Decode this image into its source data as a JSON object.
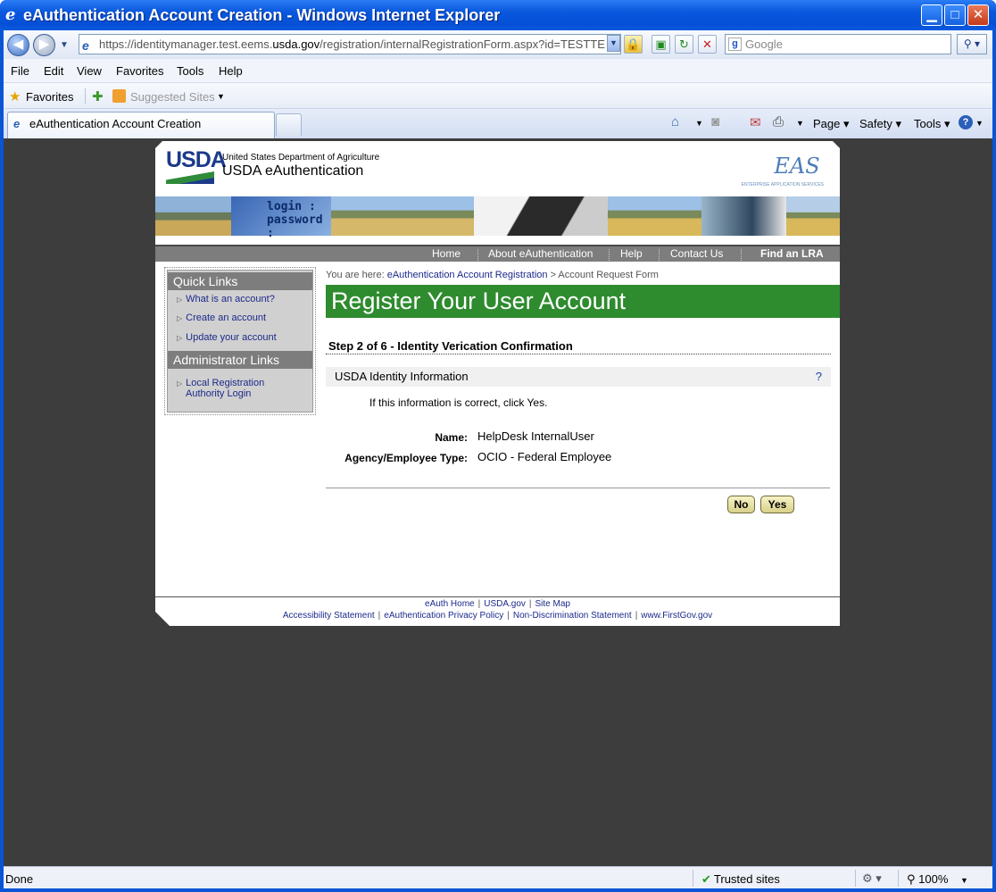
{
  "window": {
    "title": "eAuthentication Account Creation - Windows Internet Explorer",
    "minimize": "▁",
    "maximize": "□",
    "close": "✕"
  },
  "address_bar": {
    "url_prefix": "https://identitymanager.test.eems.",
    "url_domain": "usda.gov",
    "url_suffix": "/registration/internalRegistrationForm.aspx?id=TESTTE",
    "search_placeholder": "Google"
  },
  "menu": [
    "File",
    "Edit",
    "View",
    "Favorites",
    "Tools",
    "Help"
  ],
  "favorites_bar": {
    "favorites_label": "Favorites",
    "suggested_sites_label": "Suggested Sites"
  },
  "tab": {
    "title": "eAuthentication Account Creation"
  },
  "command_bar": {
    "page": "Page",
    "safety": "Safety",
    "tools": "Tools"
  },
  "site_header": {
    "logo_text": "USDA",
    "org_name": "United States Department of Agriculture",
    "site_name": "USDA eAuthentication",
    "eas_logo": "EAS",
    "eas_sub": "ENTERPRISE APPLICATION SERVICES"
  },
  "top_nav": [
    "Home",
    "About eAuthentication",
    "Help",
    "Contact Us",
    "Find an LRA"
  ],
  "sidebar": {
    "quick_links_title": "Quick Links",
    "quick_links": [
      "What is an account?",
      "Create an account",
      "Update your account"
    ],
    "admin_title": "Administrator Links",
    "admin_links": [
      "Local Registration Authority Login"
    ]
  },
  "breadcrumb": {
    "prefix": "You are here:",
    "link": "eAuthentication Account Registration",
    "current": "> Account Request Form"
  },
  "main": {
    "page_title": "Register Your User Account",
    "step_title": "Step 2 of 6 - Identity Verication Confirmation",
    "section_title": "USDA Identity Information",
    "help_icon": "?",
    "instruction": "If this information is correct, click Yes.",
    "fields": [
      {
        "label": "Name:",
        "value": "HelpDesk InternalUser"
      },
      {
        "label": "Agency/Employee Type:",
        "value": "OCIO - Federal Employee"
      }
    ],
    "no_button": "No",
    "yes_button": "Yes"
  },
  "footer": {
    "row1": [
      "eAuth Home",
      "USDA.gov",
      "Site Map"
    ],
    "row2": [
      "Accessibility Statement",
      "eAuthentication Privacy Policy",
      "Non-Discrimination Statement",
      "www.FirstGov.gov"
    ]
  },
  "status_bar": {
    "status": "Done",
    "zone": "Trusted sites",
    "zoom": "100%"
  },
  "colors": {
    "title_green": "#2e8b2e",
    "nav_gray": "#7d7d7d",
    "link_blue": "#1c2a8a",
    "xp_blue": "#0a55d6"
  }
}
